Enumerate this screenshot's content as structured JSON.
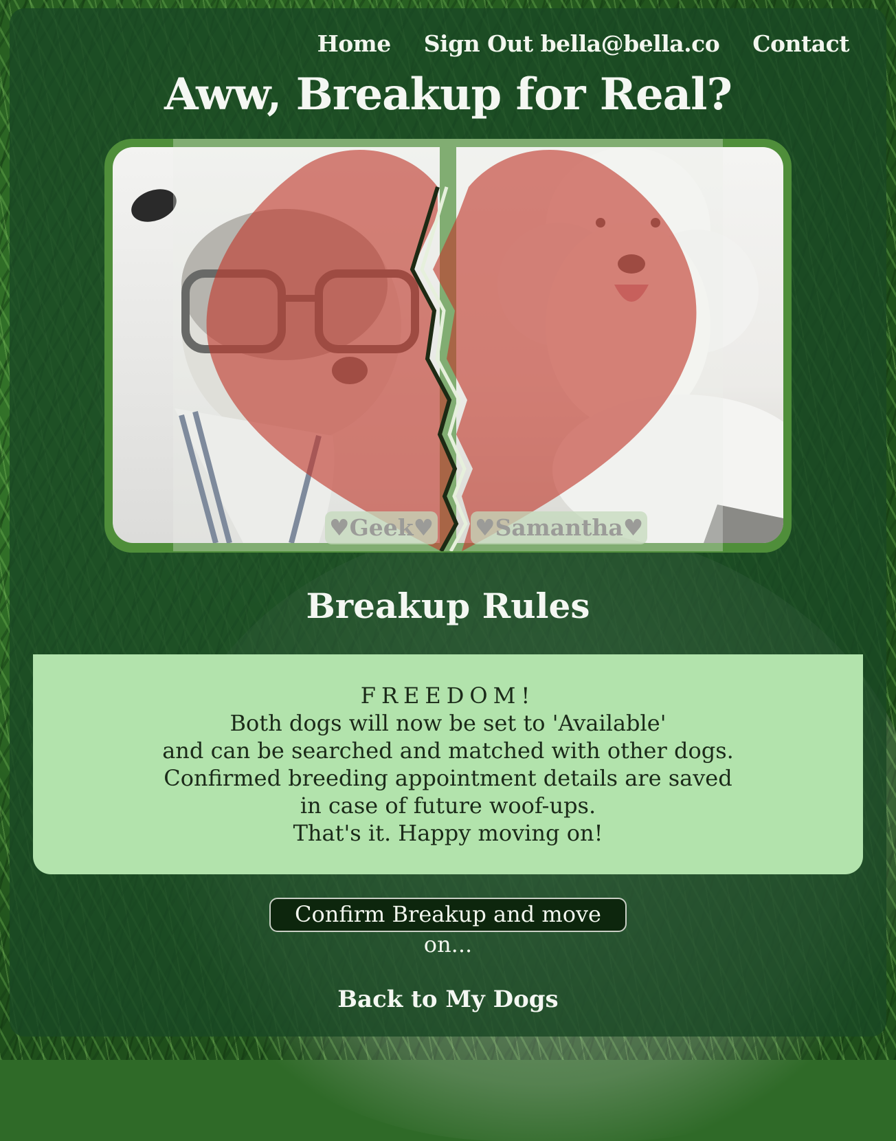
{
  "nav": {
    "home": "Home",
    "sign_out": "Sign Out bella@bella.co",
    "contact": "Contact"
  },
  "page_title": "Aww, Breakup for Real?",
  "dogs": {
    "left_name": "♥Geek♥",
    "right_name": "♥Samantha♥"
  },
  "rules": {
    "heading": "Breakup Rules",
    "title": "FREEDOM!",
    "lines": [
      "Both dogs will now be set to 'Available'",
      "and can be searched and matched with other dogs.",
      "Confirmed breeding appointment details are saved",
      "in case of future woof-ups.",
      "That's it. Happy moving on!"
    ]
  },
  "actions": {
    "confirm": "Confirm Breakup and move on...",
    "back": "Back to My Dogs"
  },
  "colors": {
    "panel": "#1a4824",
    "rules_bg": "#b2e3ac",
    "heart": "#c0392b",
    "button_bg": "#0d260d"
  }
}
